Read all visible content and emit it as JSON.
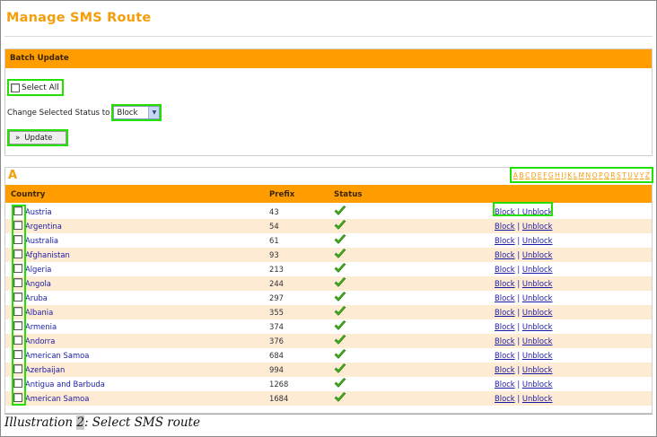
{
  "page": {
    "title": "Manage SMS Route"
  },
  "batch": {
    "header": "Batch Update",
    "select_all_label": "Select All",
    "status_label": "Change Selected Status to",
    "status_value": "Block",
    "update_label": "Update",
    "update_glyph": "»"
  },
  "list": {
    "letter": "A",
    "alphabet": [
      "A",
      "B",
      "C",
      "D",
      "E",
      "F",
      "G",
      "H",
      "I",
      "J",
      "K",
      "L",
      "M",
      "N",
      "O",
      "P",
      "Q",
      "R",
      "S",
      "T",
      "U",
      "V",
      "Y",
      "Z"
    ],
    "columns": {
      "country": "Country",
      "prefix": "Prefix",
      "status": "Status"
    },
    "action_block": "Block",
    "action_sep": " | ",
    "action_unblock": "Unblock",
    "status_icon": "checkmark-icon",
    "check_color": "#3fae1c",
    "rows": [
      {
        "country": "Austria",
        "prefix": "43"
      },
      {
        "country": "Argentina",
        "prefix": "54"
      },
      {
        "country": "Australia",
        "prefix": "61"
      },
      {
        "country": "Afghanistan",
        "prefix": "93"
      },
      {
        "country": "Algeria",
        "prefix": "213"
      },
      {
        "country": "Angola",
        "prefix": "244"
      },
      {
        "country": "Aruba",
        "prefix": "297"
      },
      {
        "country": "Albania",
        "prefix": "355"
      },
      {
        "country": "Armenia",
        "prefix": "374"
      },
      {
        "country": "Andorra",
        "prefix": "376"
      },
      {
        "country": "American Samoa",
        "prefix": "684"
      },
      {
        "country": "Azerbaijan",
        "prefix": "994"
      },
      {
        "country": "Antigua and Barbuda",
        "prefix": "1268"
      },
      {
        "country": "American Samoa",
        "prefix": "1684"
      }
    ]
  },
  "caption": {
    "prefix": "Illustration ",
    "number": "2",
    "suffix": ": Select SMS route"
  },
  "colors": {
    "accent": "#ff9c00",
    "title": "#f59e0b",
    "link": "#1a1aa6",
    "alt_row": "#feebd3",
    "highlight": "#22e000"
  }
}
